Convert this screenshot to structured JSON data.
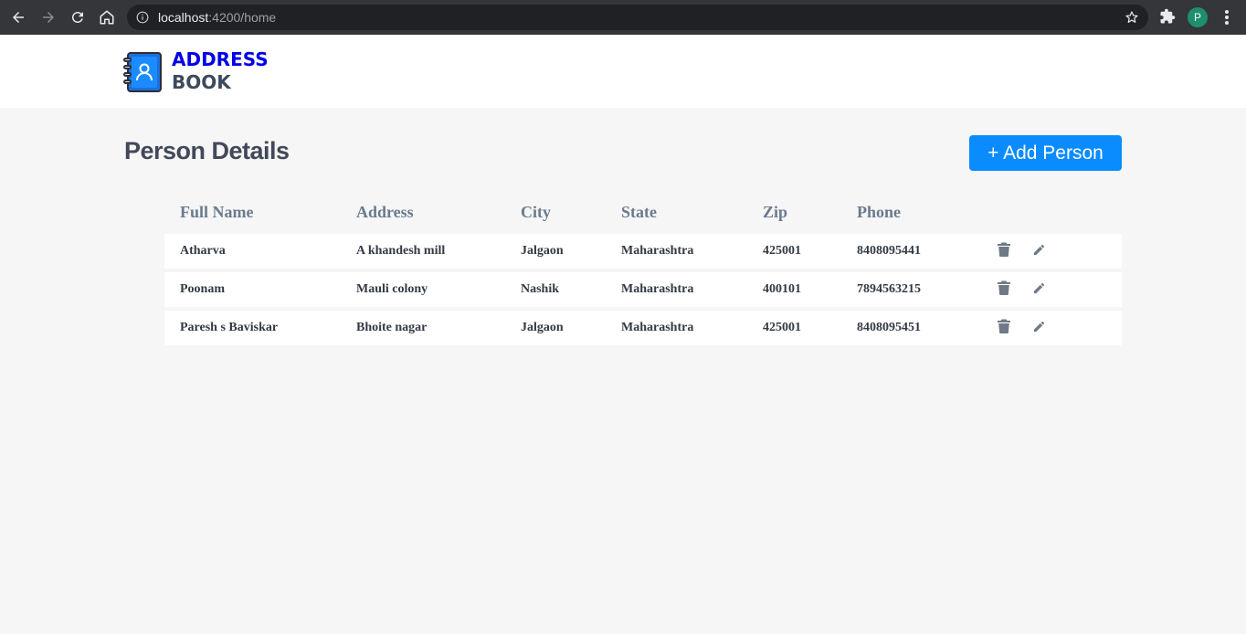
{
  "browser": {
    "url_host": "localhost",
    "url_path": ":4200/home",
    "profile_initial": "P"
  },
  "app": {
    "logo_line1": "ADDRESS",
    "logo_line2": "BOOK",
    "brand_colors": {
      "primary": "#0000e6",
      "secondary": "#3d4a5c",
      "accent": "#0a8cff"
    }
  },
  "page": {
    "title": "Person Details",
    "add_button": "+ Add Person"
  },
  "table": {
    "columns": [
      "Full Name",
      "Address",
      "City",
      "State",
      "Zip",
      "Phone"
    ],
    "rows": [
      {
        "full_name": "Atharva",
        "address": "A khandesh mill",
        "city": "Jalgaon",
        "state": "Maharashtra",
        "zip": "425001",
        "phone": "8408095441"
      },
      {
        "full_name": "Poonam",
        "address": "Mauli colony",
        "city": "Nashik",
        "state": "Maharashtra",
        "zip": "400101",
        "phone": "7894563215"
      },
      {
        "full_name": "Paresh s Baviskar",
        "address": "Bhoite nagar",
        "city": "Jalgaon",
        "state": "Maharashtra",
        "zip": "425001",
        "phone": "8408095451"
      }
    ],
    "row_actions": [
      "delete-icon",
      "edit-icon"
    ]
  }
}
